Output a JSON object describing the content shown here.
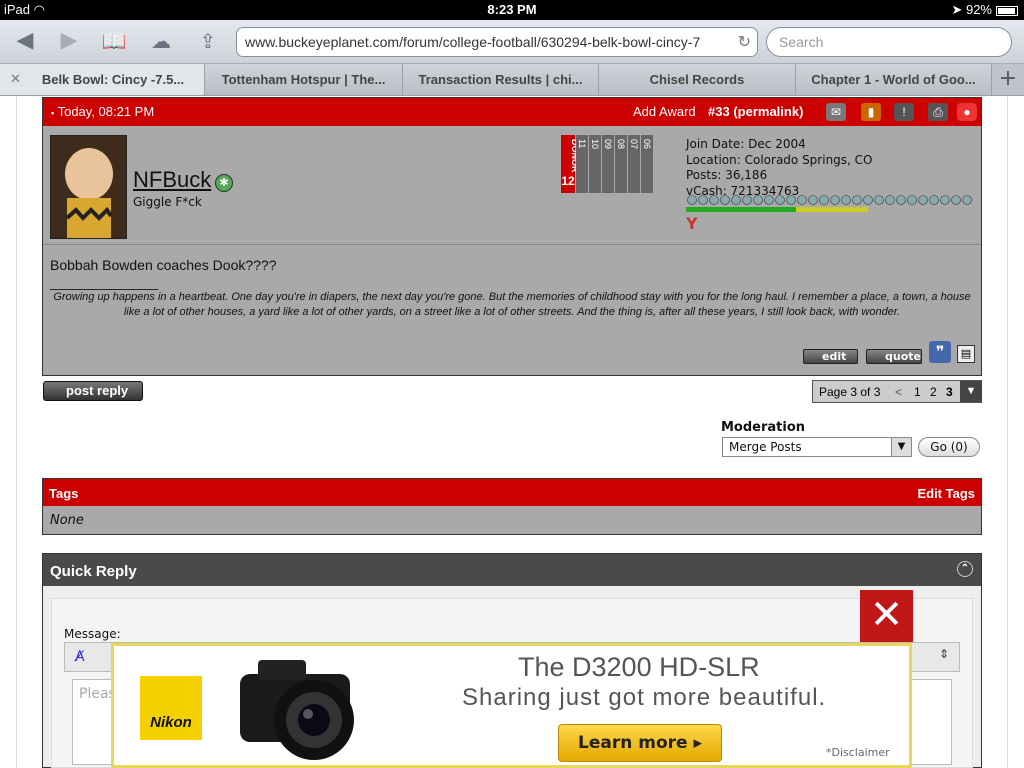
{
  "status": {
    "device": "iPad",
    "time": "8:23 PM",
    "battery": "92%",
    "battery_level": 0.92
  },
  "toolbar": {
    "url": "www.buckeyeplanet.com/forum/college-football/630294-belk-bowl-cincy-7",
    "search_placeholder": "Search"
  },
  "tabs": [
    {
      "label": "Belk Bowl: Cincy -7.5..."
    },
    {
      "label": "Tottenham Hotspur | The..."
    },
    {
      "label": "Transaction Results | chi..."
    },
    {
      "label": "Chisel Records"
    },
    {
      "label": "Chapter 1 - World of Goo..."
    }
  ],
  "post": {
    "date": "Today, 08:21 PM",
    "add_award": "Add Award",
    "number": "#33",
    "permalink": "(permalink)",
    "username": "NFBuck",
    "usertitle": "Giggle F*ck",
    "donor_label": "DONOR",
    "donor_years": [
      "12",
      "11",
      "10",
      "09",
      "08",
      "07",
      "06"
    ],
    "join_date": "Join Date: Dec 2004",
    "location": "Location: Colorado Springs, CO",
    "posts": "Posts: 36,186",
    "vcash": "vCash: 721334763",
    "message": "Bobbah Bowden coaches Dook????",
    "sig_separator": "__________________",
    "signature": "Growing up happens in a heartbeat. One day you're in diapers, the next day you're gone. But the memories of childhood stay with you for the long haul. I remember a place, a town, a house like a lot of other houses, a yard like a lot of other yards, on a street like a lot of other streets. And the thing is, after all these years, I still look back, with wonder.",
    "edit": "edit",
    "quote": "quote"
  },
  "post_reply": "post reply",
  "pagenav": {
    "label": "Page 3 of 3",
    "prev": "<",
    "pages": [
      "1",
      "2",
      "3"
    ],
    "current": "3"
  },
  "moderation": {
    "label": "Moderation",
    "selected": "Merge Posts",
    "go": "Go (0)"
  },
  "tags": {
    "title": "Tags",
    "edit": "Edit Tags",
    "value": "None"
  },
  "quick_reply": {
    "title": "Quick Reply",
    "message_label": "Message:",
    "placeholder": "Pleas"
  },
  "ad": {
    "headline": "The D3200 HD-SLR",
    "tagline": "Sharing just got more beautiful.",
    "cta": "Learn more",
    "brand": "Nikon",
    "disclaimer": "*Disclaimer",
    "close": "✕"
  },
  "colors": {
    "accent_red": "#cc0000",
    "post_bg": "#a9a9a9",
    "quick_head": "#4a4a4a"
  }
}
